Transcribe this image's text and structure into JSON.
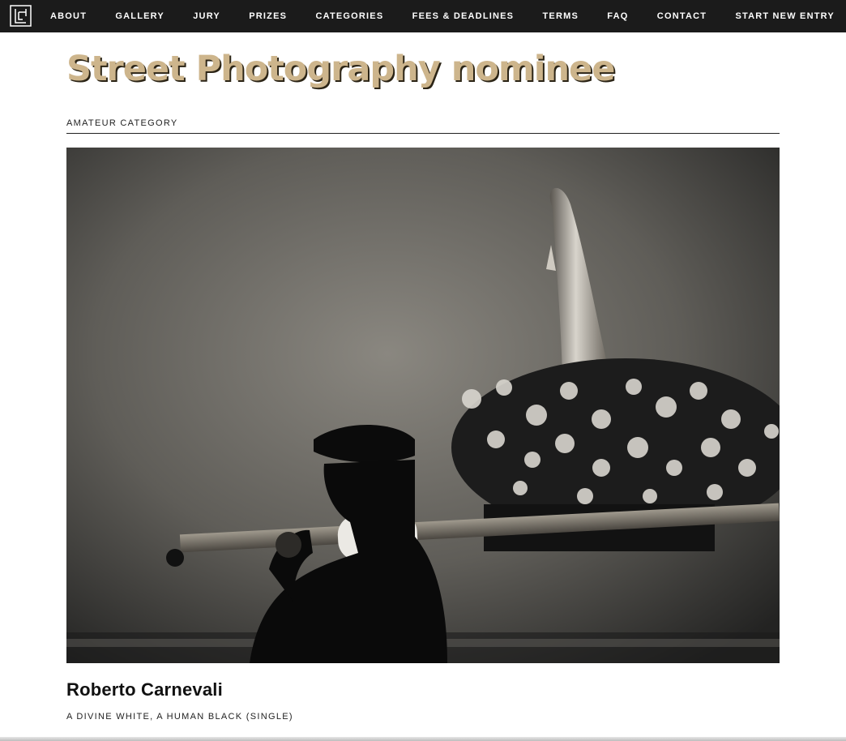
{
  "nav": {
    "items": [
      {
        "label": "About"
      },
      {
        "label": "Gallery"
      },
      {
        "label": "Jury"
      },
      {
        "label": "Prizes"
      },
      {
        "label": "Categories"
      },
      {
        "label": "Fees & Deadlines"
      },
      {
        "label": "Terms"
      },
      {
        "label": "FAQ"
      },
      {
        "label": "Contact"
      },
      {
        "label": "Start New Entry"
      }
    ]
  },
  "entry": {
    "title": "Street Photography nominee",
    "category": "Amateur category",
    "author": "Roberto Carnevali",
    "work_title": "A divine white, a human black (single)"
  },
  "icons": {
    "logo": "site-logo-icon"
  },
  "colors": {
    "nav_background": "#1b1b1b",
    "title_gold": "#cdb58c"
  }
}
